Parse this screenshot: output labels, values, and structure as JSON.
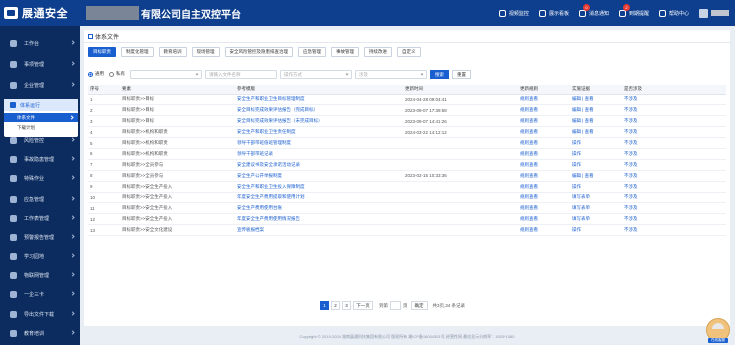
{
  "header": {
    "logo_text": "展通安全",
    "platform_title": "有限公司自主双控平台",
    "nav": [
      {
        "label": "视频监控",
        "icon": "video-icon",
        "badge": ""
      },
      {
        "label": "展示看板",
        "icon": "dashboard-icon",
        "badge": ""
      },
      {
        "label": "消息通知",
        "icon": "message-icon",
        "badge": "0"
      },
      {
        "label": "到期提醒",
        "icon": "bell-icon",
        "badge": "2"
      },
      {
        "label": "帮助中心",
        "icon": "help-icon",
        "badge": ""
      }
    ]
  },
  "sidebar": {
    "items": [
      {
        "label": "工作台",
        "icon": "workbench-icon"
      },
      {
        "label": "事项管理",
        "icon": "task-icon"
      },
      {
        "label": "企业管理",
        "icon": "enterprise-icon"
      },
      {
        "label": "风险管控",
        "icon": "risk-icon"
      },
      {
        "label": "事故隐患管理",
        "icon": "hazard-icon"
      },
      {
        "label": "特殊作业",
        "icon": "work-icon"
      },
      {
        "label": "应急管理",
        "icon": "emergency-icon"
      },
      {
        "label": "工作表管理",
        "icon": "sheet-icon"
      },
      {
        "label": "预警报告管理",
        "icon": "warning-icon"
      },
      {
        "label": "学习园地",
        "icon": "study-icon"
      },
      {
        "label": "物联网管理",
        "icon": "iot-icon"
      },
      {
        "label": "一企三卡",
        "icon": "card-icon"
      },
      {
        "label": "导出文件下载",
        "icon": "download-icon"
      },
      {
        "label": "教育培训",
        "icon": "training-icon"
      }
    ],
    "submenu": {
      "parent": "体系运行",
      "items": [
        {
          "label": "体系文件",
          "active": true
        },
        {
          "label": "下载计划",
          "active": false
        }
      ]
    }
  },
  "page": {
    "title": "体系文件",
    "tabs": [
      "目标职责",
      "制度化管理",
      "教育培训",
      "现场管理",
      "安全风险管控及隐患排查治理",
      "应急管理",
      "事故管理",
      "持续改进",
      "自定义"
    ],
    "active_tab": 0,
    "filter": {
      "radio_general": "通用",
      "radio_private": "私有",
      "search_placeholder": "请输入文件名称",
      "operation_placeholder": "操作方式",
      "involve_placeholder": "涉及",
      "search_button": "搜索",
      "reset_button": "重置"
    },
    "table": {
      "headers": [
        "序号",
        "要素",
        "参考模版",
        "更新时间",
        "更新规则",
        "实施证据",
        "是否涉及"
      ],
      "rows": [
        {
          "no": "1",
          "element": "目标职责>>目标",
          "template": "安全生产和职业卫生目标管理制度",
          "time": "2024-04-28 09:04:41",
          "rule": "规则查看",
          "evidence": "编辑 | 查看",
          "involved": "不涉及"
        },
        {
          "no": "2",
          "element": "目标职责>>目标",
          "template": "安全目标完成效果评估报告（完成目标）",
          "time": "2023-09-07 17:39:58",
          "rule": "规则查看",
          "evidence": "编辑 | 查看",
          "involved": "不涉及"
        },
        {
          "no": "3",
          "element": "目标职责>>目标",
          "template": "安全目标完成效果评估报告（未完成目标）",
          "time": "2023-09-07 14:41:26",
          "rule": "规则查看",
          "evidence": "编辑 | 查看",
          "involved": "不涉及"
        },
        {
          "no": "4",
          "element": "目标职责>>机构和职责",
          "template": "安全生产和职业卫生责任制度",
          "time": "2024-03-22 14:12:12",
          "rule": "规则查看",
          "evidence": "编辑 | 查看",
          "involved": "不涉及"
        },
        {
          "no": "5",
          "element": "目标职责>>机构和职责",
          "template": "领导干部带班值班管理制度",
          "time": "",
          "rule": "规则查看",
          "evidence": "操作",
          "involved": "不涉及"
        },
        {
          "no": "6",
          "element": "目标职责>>机构和职责",
          "template": "领导干部带班记录",
          "time": "",
          "rule": "规则查看",
          "evidence": "操作",
          "involved": "不涉及"
        },
        {
          "no": "7",
          "element": "目标职责>>全员参与",
          "template": "安全建议书及安全承诺活动记录",
          "time": "",
          "rule": "规则查看",
          "evidence": "操作",
          "involved": "不涉及"
        },
        {
          "no": "8",
          "element": "目标职责>>全员参与",
          "template": "安全生产公开举报制度",
          "time": "2023-02-15 10:33:36",
          "rule": "规则查看",
          "evidence": "编辑 | 查看",
          "involved": "不涉及"
        },
        {
          "no": "9",
          "element": "目标职责>>安全生产投入",
          "template": "安全生产和职业卫生投入保障制度",
          "time": "",
          "rule": "规则查看",
          "evidence": "操作",
          "involved": "不涉及"
        },
        {
          "no": "10",
          "element": "目标职责>>安全生产投入",
          "template": "年度安全生产费用提取和使用计划",
          "time": "",
          "rule": "规则查看",
          "evidence": "填写表单",
          "involved": "不涉及"
        },
        {
          "no": "11",
          "element": "目标职责>>安全生产投入",
          "template": "安全生产费用使用台账",
          "time": "",
          "rule": "规则查看",
          "evidence": "填写表单",
          "involved": "不涉及"
        },
        {
          "no": "12",
          "element": "目标职责>>安全生产投入",
          "template": "年度安全生产费用使用情况报告",
          "time": "",
          "rule": "规则查看",
          "evidence": "填写表单",
          "involved": "不涉及"
        },
        {
          "no": "13",
          "element": "目标职责>>安全文化建设",
          "template": "宣传板报档案",
          "time": "",
          "rule": "规则查看",
          "evidence": "操作",
          "involved": "不涉及"
        }
      ]
    },
    "pagination": {
      "pages": [
        "1",
        "2",
        "3"
      ],
      "active_page": "1",
      "next": "下一页",
      "goto_label": "到第",
      "page_unit": "页",
      "confirm": "确定",
      "total": "共3页,34 条记录"
    }
  },
  "footer": {
    "text": "Copyright © 2019-2024 湖南展通科技集团有限公司 版权所有 湘ICP备18004301号-经营性网   最佳显示分辨率：1920*1080"
  },
  "helper": {
    "label": "在线客服"
  },
  "colors": {
    "header_bg": "#0e3f8e",
    "sidebar_bg": "#0c2c5f",
    "accent": "#1a5fd0",
    "badge": "#e53935"
  }
}
